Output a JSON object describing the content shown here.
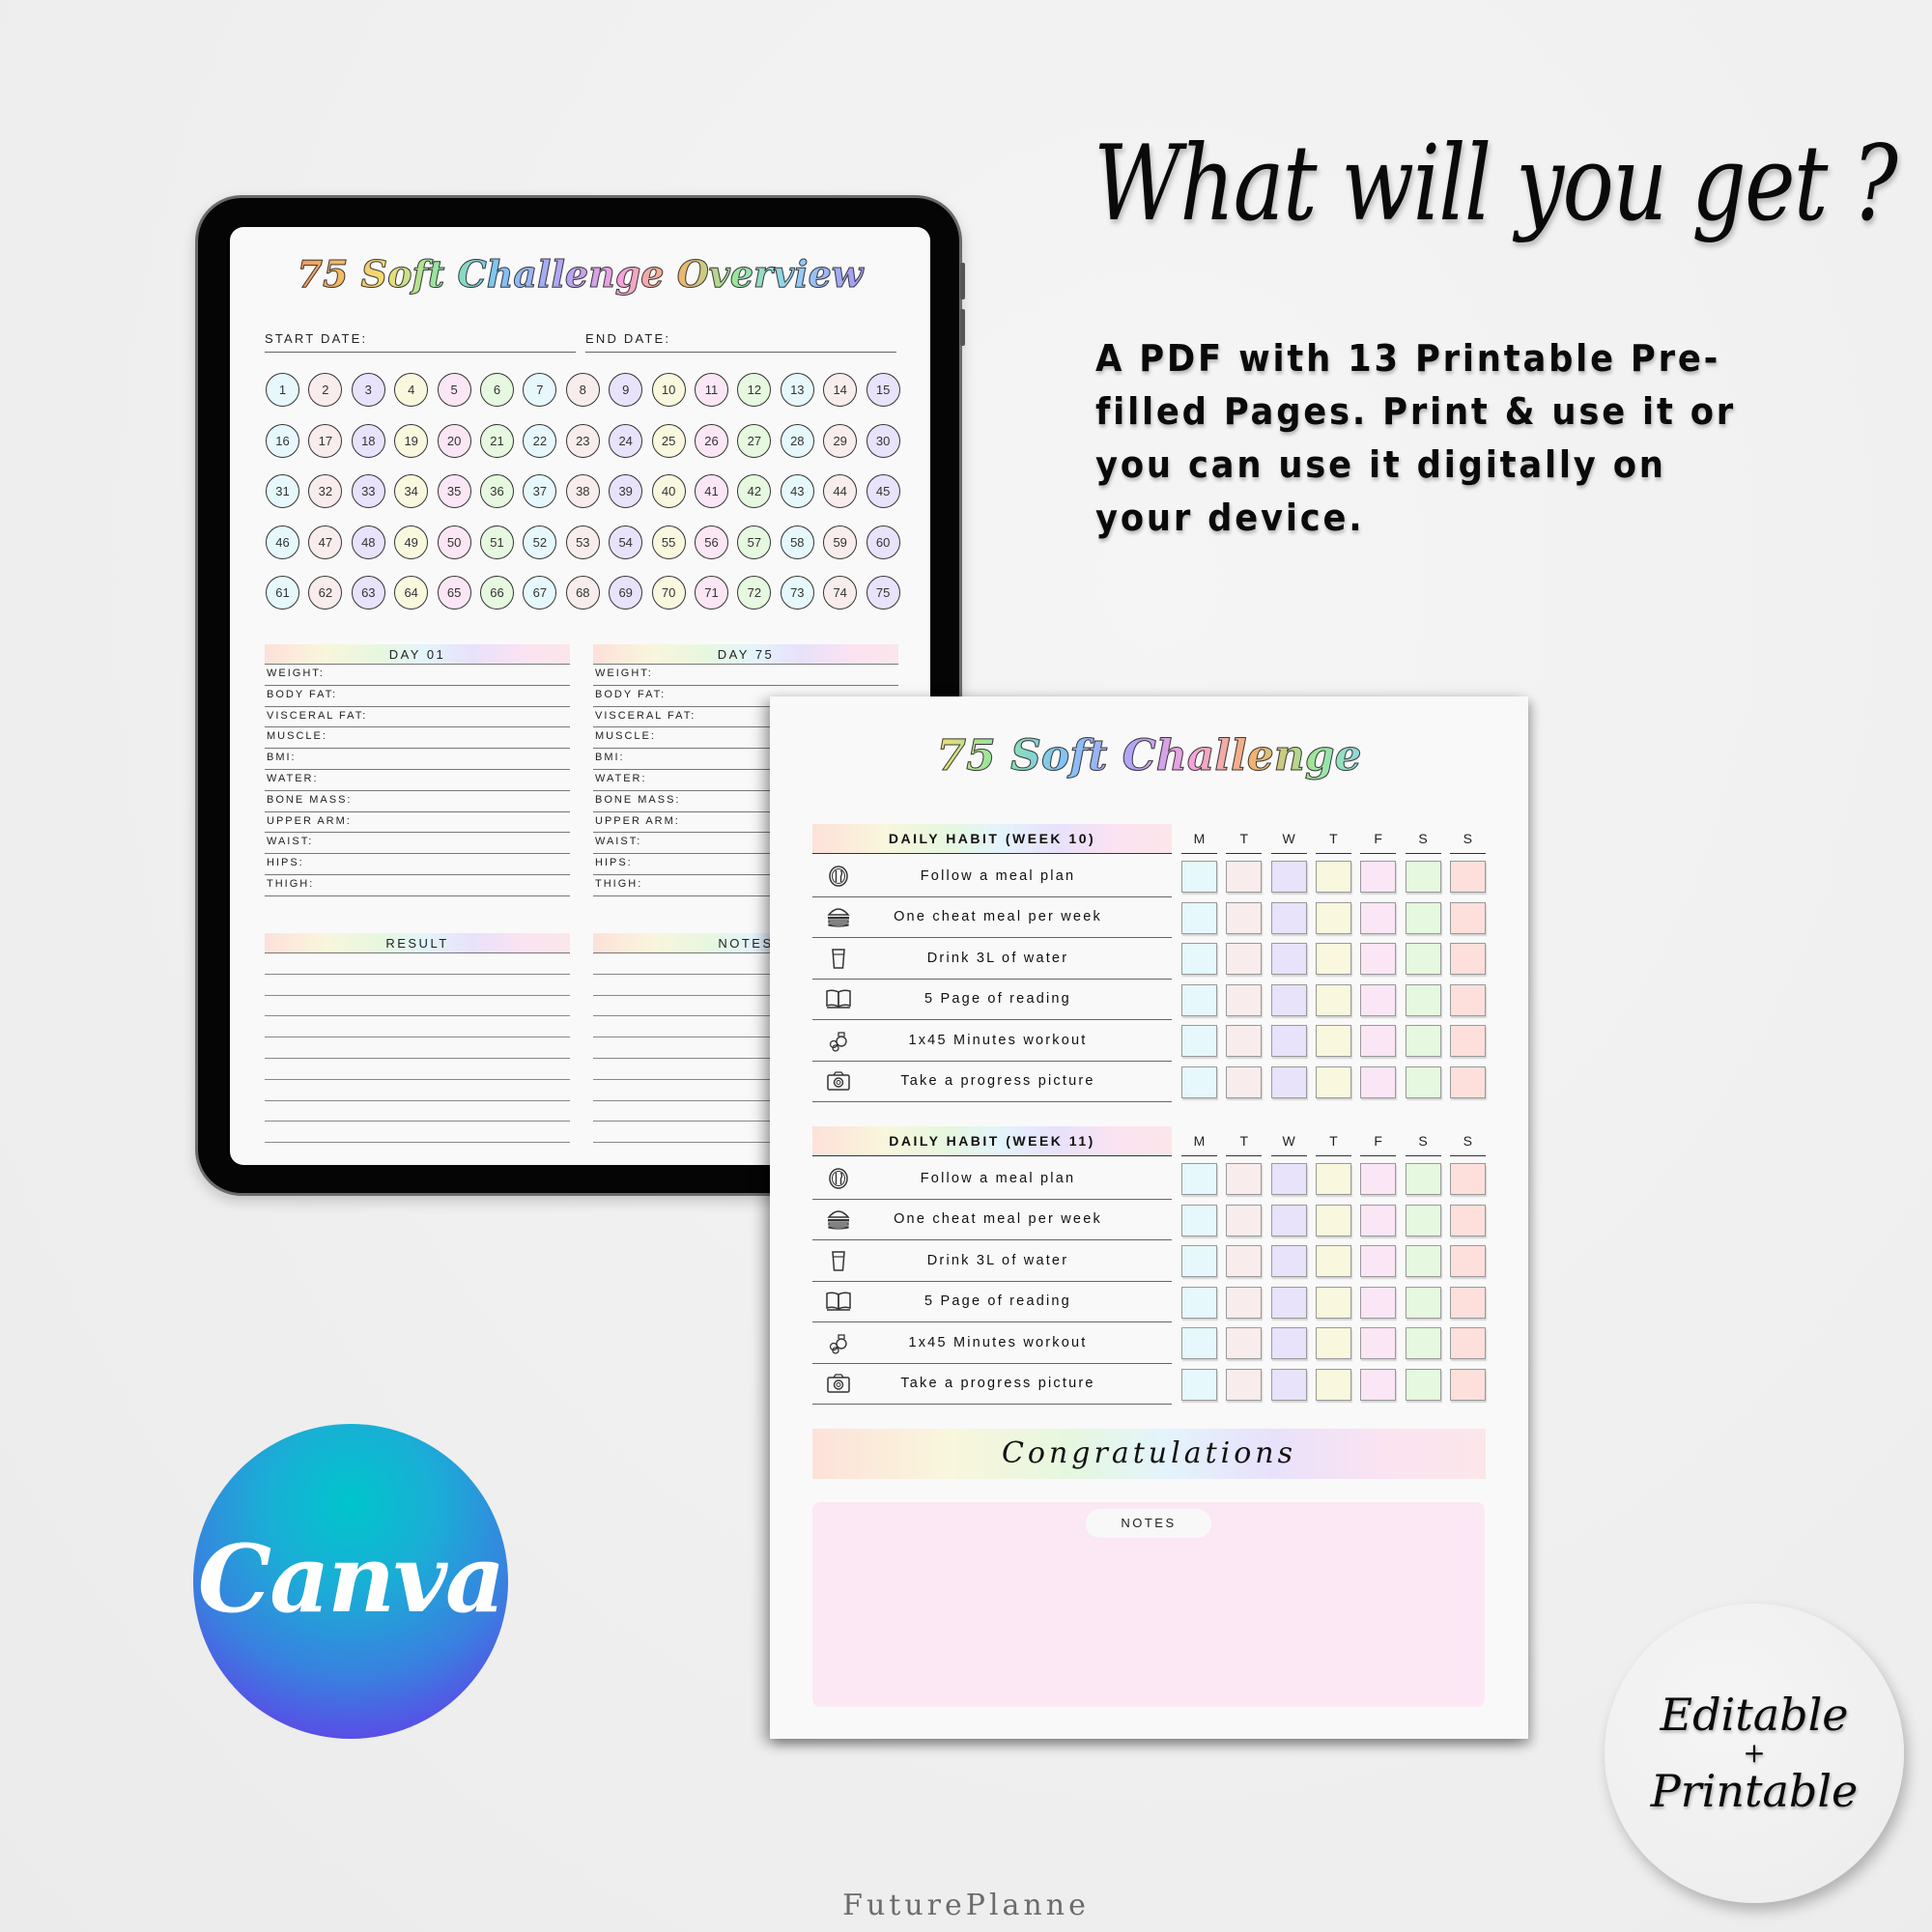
{
  "headline": "What will you get ?",
  "description": "A PDF with 13 Printable Pre-filled Pages. Print & use it or you can use it digitally on your device.",
  "tablet": {
    "title": "75 Soft Challenge Overview",
    "start_date_label": "START DATE:",
    "end_date_label": "END DATE:",
    "day_numbers": [
      "1",
      "2",
      "3",
      "4",
      "5",
      "6",
      "7",
      "8",
      "9",
      "10",
      "11",
      "12",
      "13",
      "14",
      "15",
      "16",
      "17",
      "18",
      "19",
      "20",
      "21",
      "22",
      "23",
      "24",
      "25",
      "26",
      "27",
      "28",
      "29",
      "30",
      "31",
      "32",
      "33",
      "34",
      "35",
      "36",
      "37",
      "38",
      "39",
      "40",
      "41",
      "42",
      "43",
      "44",
      "45",
      "46",
      "47",
      "48",
      "49",
      "50",
      "51",
      "52",
      "53",
      "54",
      "55",
      "56",
      "57",
      "58",
      "59",
      "60",
      "61",
      "62",
      "63",
      "64",
      "65",
      "66",
      "67",
      "68",
      "69",
      "70",
      "71",
      "72",
      "73",
      "74",
      "75"
    ],
    "circle_colors": [
      "#e6f8fc",
      "#f8ecec",
      "#e9e2fb",
      "#f9f8de",
      "#fbe6f5",
      "#e6f8df",
      "#e6f8fc",
      "#f8ecec",
      "#e9e2fb",
      "#f9f8de",
      "#fbe6f5",
      "#e6f8df",
      "#e6f8fc",
      "#f8ecec",
      "#e9e2fb"
    ],
    "day_start": {
      "heading": "DAY 01",
      "fields": [
        "WEIGHT:",
        "BODY FAT:",
        "VISCERAL FAT:",
        "MUSCLE:",
        "BMI:",
        "WATER:",
        "BONE MASS:",
        "UPPER ARM:",
        "WAIST:",
        "HIPS:",
        "THIGH:"
      ]
    },
    "day_end": {
      "heading": "DAY 75",
      "fields": [
        "WEIGHT:",
        "BODY FAT:",
        "VISCERAL FAT:",
        "MUSCLE:",
        "BMI:",
        "WATER:",
        "BONE MASS:",
        "UPPER ARM:",
        "WAIST:",
        "HIPS:",
        "THIGH:"
      ]
    },
    "result_heading": "RESULT",
    "notes_heading": "NOTES"
  },
  "sheet": {
    "title": "75 Soft Challenge",
    "days": [
      "M",
      "T",
      "W",
      "T",
      "F",
      "S",
      "S"
    ],
    "checkbox_colors": [
      "#e6f8fc",
      "#f9ecec",
      "#e9e2fb",
      "#f9f8de",
      "#fbe6f5",
      "#e6f8df",
      "#fde0dc"
    ],
    "weeks": [
      {
        "heading": "DAILY HABIT (WEEK 10)",
        "habits": [
          {
            "icon": "plate-cutlery-icon",
            "label": "Follow a meal plan"
          },
          {
            "icon": "burger-icon",
            "label": "One cheat meal per week"
          },
          {
            "icon": "water-glass-icon",
            "label": "Drink 3L of water"
          },
          {
            "icon": "book-icon",
            "label": "5 Page of reading"
          },
          {
            "icon": "kettlebell-icon",
            "label": "1x45 Minutes workout"
          },
          {
            "icon": "camera-icon",
            "label": "Take a progress picture"
          }
        ]
      },
      {
        "heading": "DAILY HABIT (WEEK 11)",
        "habits": [
          {
            "icon": "plate-cutlery-icon",
            "label": "Follow a meal plan"
          },
          {
            "icon": "burger-icon",
            "label": "One cheat meal per week"
          },
          {
            "icon": "water-glass-icon",
            "label": "Drink 3L of water"
          },
          {
            "icon": "book-icon",
            "label": "5 Page of reading"
          },
          {
            "icon": "kettlebell-icon",
            "label": "1x45 Minutes workout"
          },
          {
            "icon": "camera-icon",
            "label": "Take a progress picture"
          }
        ]
      }
    ],
    "congrats": "Congratulations",
    "notes_label": "NOTES"
  },
  "badges": {
    "canva": "Canva",
    "editable": "Editable",
    "plus": "+",
    "printable": "Printable"
  },
  "brand": "FuturePlanne"
}
